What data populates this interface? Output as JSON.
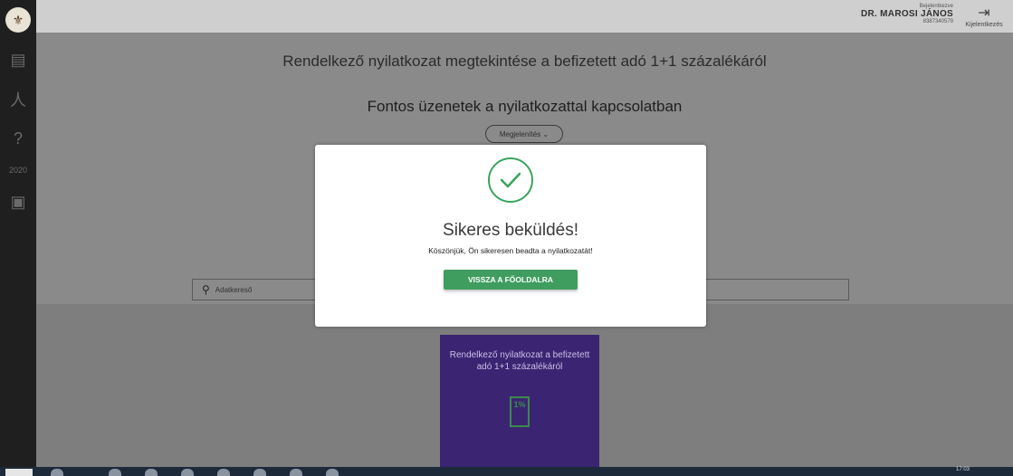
{
  "sidebar": {
    "logo_icon": "crest-logo",
    "items": [
      {
        "icon": "document-list-icon",
        "glyph": "▤"
      },
      {
        "icon": "person-icon",
        "glyph": "⼈"
      },
      {
        "icon": "help-icon",
        "glyph": "?"
      },
      {
        "icon": "calendar-2020-icon",
        "glyph": "2020"
      },
      {
        "icon": "form-icon",
        "glyph": "▣"
      }
    ]
  },
  "header": {
    "user_caption": "Bejelentkezve",
    "user_name": "DR. MAROSI JÁNOS",
    "user_id": "8387340579",
    "logout_label": "Kijelentkezés"
  },
  "main": {
    "page_title": "Rendelkező nyilatkozat megtekintése a befizetett adó 1+1 százalékáról",
    "section_title": "Fontos üzenetek a nyilatkozattal kapcsolatban",
    "toggle_label": "Megjelenítés",
    "search_placeholder": "Adatkereső",
    "card": {
      "title": "Rendelkező nyilatkozat a befizetett adó 1+1 százalékáról",
      "icon_label": "1%"
    }
  },
  "modal": {
    "title": "Sikeres beküldés!",
    "message": "Köszönjük, Ön sikeresen beadta a nyilatkozatát!",
    "button_label": "VISSZA A FŐOLDALRA"
  },
  "taskbar": {
    "clock": "17:03"
  },
  "colors": {
    "accent_green": "#3f9d5f",
    "card_purple": "#3b2472",
    "overlay_gray": "#8a8a8a"
  }
}
